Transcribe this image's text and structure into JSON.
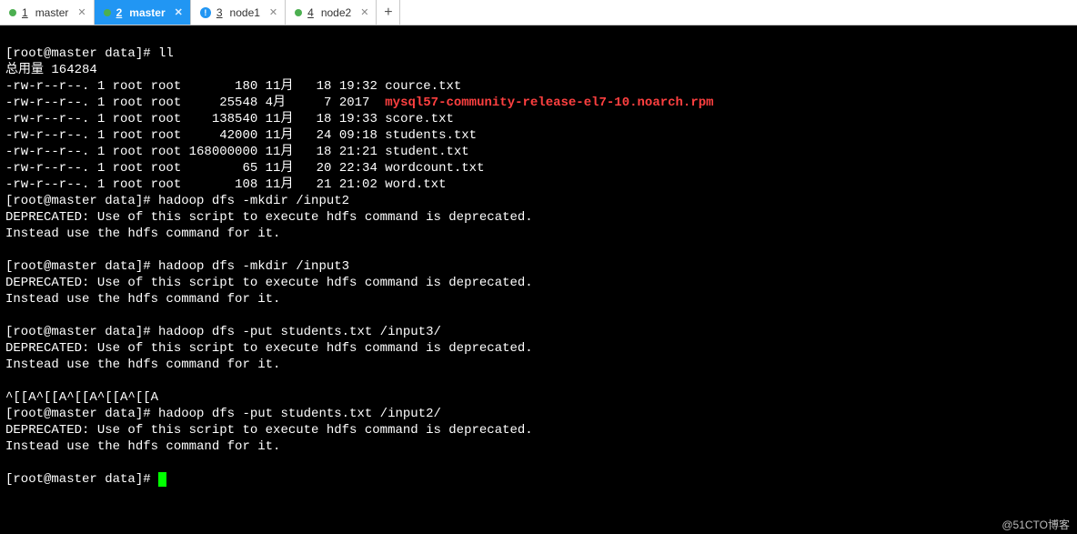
{
  "tabs": [
    {
      "dot": "green",
      "num": "1",
      "label": "master"
    },
    {
      "dot": "green",
      "num": "2",
      "label": "master",
      "active": true
    },
    {
      "dot": "info",
      "num": "3",
      "label": "node1"
    },
    {
      "dot": "green",
      "num": "4",
      "label": "node2"
    }
  ],
  "addtab_label": "+",
  "prompt": "[root@master data]# ",
  "terminal": {
    "cmd_ll": "ll",
    "total_line": "总用量 164284",
    "files": [
      {
        "perm": "-rw-r--r--.",
        "links": "1",
        "own": "root",
        "grp": "root",
        "size": "180",
        "mon": "11月",
        "day": "18",
        "time": "19:32",
        "name": "cource.txt"
      },
      {
        "perm": "-rw-r--r--.",
        "links": "1",
        "own": "root",
        "grp": "root",
        "size": "25548",
        "mon": "4月",
        "day": "7",
        "time": "2017",
        "name": "mysql57-community-release-el7-10.noarch.rpm",
        "red": true
      },
      {
        "perm": "-rw-r--r--.",
        "links": "1",
        "own": "root",
        "grp": "root",
        "size": "138540",
        "mon": "11月",
        "day": "18",
        "time": "19:33",
        "name": "score.txt"
      },
      {
        "perm": "-rw-r--r--.",
        "links": "1",
        "own": "root",
        "grp": "root",
        "size": "42000",
        "mon": "11月",
        "day": "24",
        "time": "09:18",
        "name": "students.txt"
      },
      {
        "perm": "-rw-r--r--.",
        "links": "1",
        "own": "root",
        "grp": "root",
        "size": "168000000",
        "mon": "11月",
        "day": "18",
        "time": "21:21",
        "name": "student.txt"
      },
      {
        "perm": "-rw-r--r--.",
        "links": "1",
        "own": "root",
        "grp": "root",
        "size": "65",
        "mon": "11月",
        "day": "20",
        "time": "22:34",
        "name": "wordcount.txt"
      },
      {
        "perm": "-rw-r--r--.",
        "links": "1",
        "own": "root",
        "grp": "root",
        "size": "108",
        "mon": "11月",
        "day": "21",
        "time": "21:02",
        "name": "word.txt"
      }
    ],
    "cmd_mkdir_input2": "hadoop dfs -mkdir /input2",
    "deprecated1": "DEPRECATED: Use of this script to execute hdfs command is deprecated.",
    "deprecated2": "Instead use the hdfs command for it.",
    "cmd_mkdir_input3": "hadoop dfs -mkdir /input3",
    "cmd_put_input3": "hadoop dfs -put students.txt /input3/",
    "garble": "^[[A^[[A^[[A^[[A^[[A",
    "cmd_put_input2": "hadoop dfs -put students.txt /input2/"
  },
  "watermark": "@51CTO博客"
}
